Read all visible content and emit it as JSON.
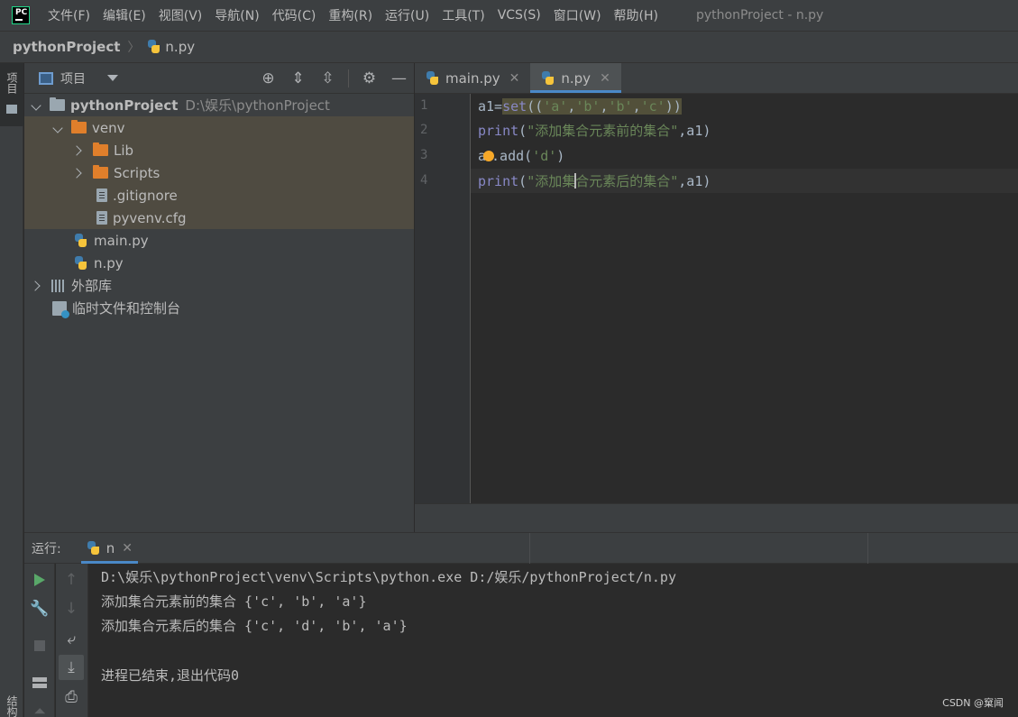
{
  "menubar": {
    "logo": "PC",
    "items": [
      "文件(F)",
      "编辑(E)",
      "视图(V)",
      "导航(N)",
      "代码(C)",
      "重构(R)",
      "运行(U)",
      "工具(T)",
      "VCS(S)",
      "窗口(W)",
      "帮助(H)"
    ],
    "window_title": "pythonProject - n.py"
  },
  "navbar": {
    "project": "pythonProject",
    "file": "n.py"
  },
  "left_stripe": {
    "top_tab": "项目",
    "bottom_tab": "结构"
  },
  "project_panel": {
    "title": "项目",
    "tools": [
      "locate-icon",
      "expand-all-icon",
      "collapse-all-icon",
      "gear-icon",
      "hide-icon"
    ],
    "tree": [
      {
        "label": "pythonProject",
        "path": "D:\\娱乐\\pythonProject"
      },
      {
        "label": "venv"
      },
      {
        "label": "Lib"
      },
      {
        "label": "Scripts"
      },
      {
        "label": ".gitignore"
      },
      {
        "label": "pyvenv.cfg"
      },
      {
        "label": "main.py"
      },
      {
        "label": "n.py"
      },
      {
        "label": "外部库"
      },
      {
        "label": "临时文件和控制台"
      }
    ]
  },
  "editor": {
    "tabs": [
      {
        "label": "main.py",
        "active": false
      },
      {
        "label": "n.py",
        "active": true
      }
    ],
    "line_numbers": [
      "1",
      "2",
      "3",
      "4"
    ],
    "code": {
      "l1": {
        "a": "a1=",
        "b": "set",
        "c": "((",
        "d": "'a'",
        "e": ",",
        "f": "'b'",
        "g": ",",
        "h": "'b'",
        "i": ",",
        "j": "'c'",
        "k": "))"
      },
      "l2": {
        "a": "print",
        "b": "(",
        "c": "\"添加集合元素前的集合\"",
        "d": ",a1)"
      },
      "l3": {
        "a": "a",
        "b": ".add(",
        "c": "'d'",
        "d": ")"
      },
      "l4": {
        "a": "print",
        "b": "(",
        "c": "\"添加集",
        "c2": "合元素后的集合\"",
        "d": ",a1)"
      }
    }
  },
  "run_panel": {
    "label": "运行:",
    "tab": "n",
    "console": [
      "D:\\娱乐\\pythonProject\\venv\\Scripts\\python.exe D:/娱乐/pythonProject/n.py",
      "添加集合元素前的集合 {'c', 'b', 'a'}",
      "添加集合元素后的集合 {'c', 'd', 'b', 'a'}",
      "",
      "进程已结束,退出代码0"
    ]
  },
  "watermark": "CSDN @窠闻",
  "colors": {
    "keyword": "#8888c6",
    "string": "#6a8759",
    "accent": "#4a88c7",
    "run_green": "#59a869"
  }
}
